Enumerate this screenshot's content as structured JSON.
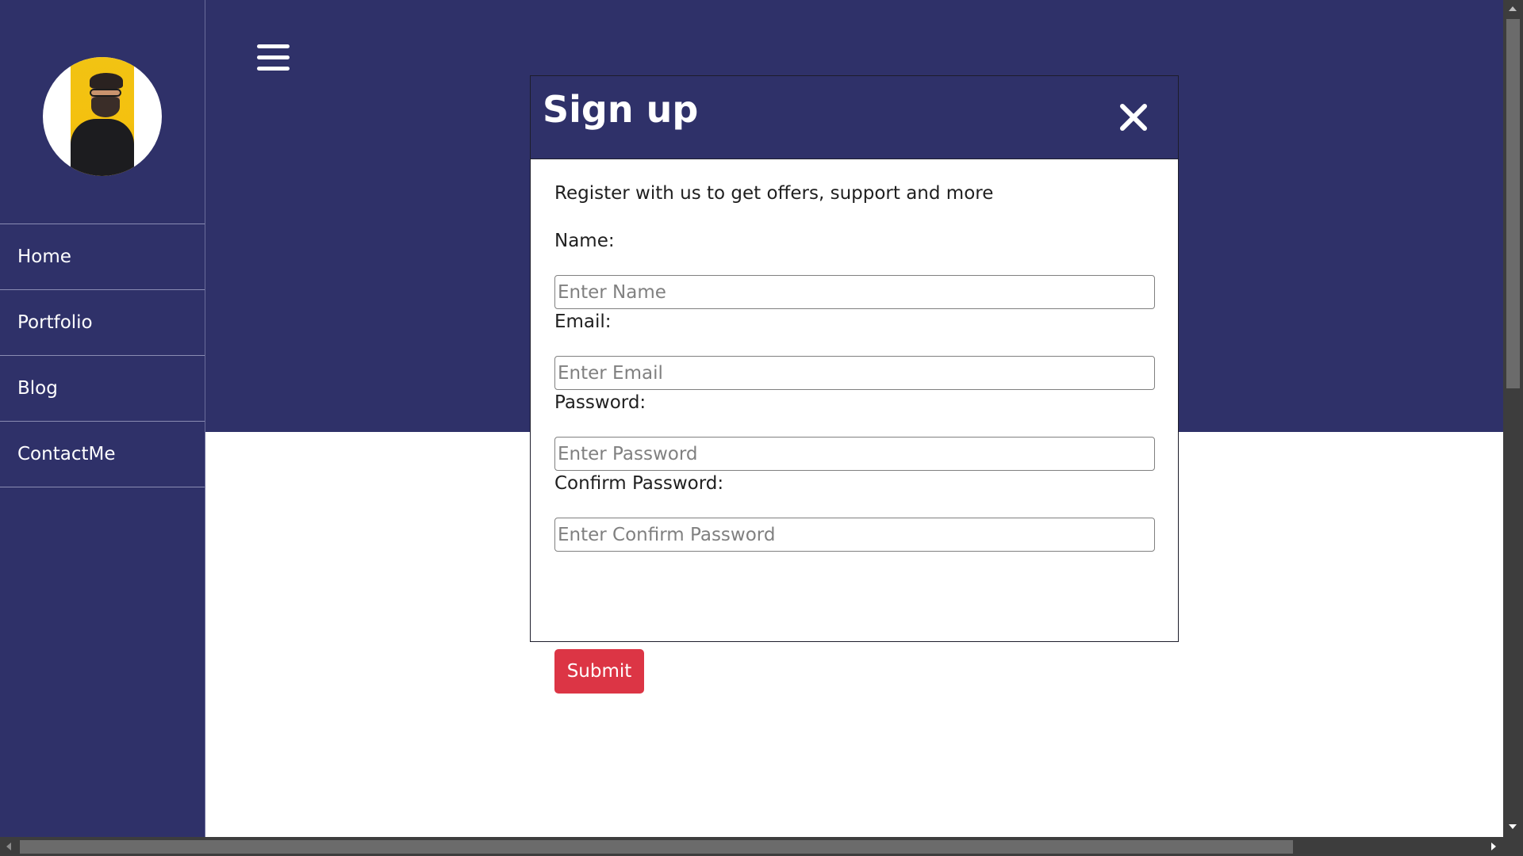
{
  "colors": {
    "brand": "#2f3169",
    "submit": "#dc3545"
  },
  "sidebar": {
    "avatar": "profile-photo",
    "items": [
      {
        "label": "Home"
      },
      {
        "label": "Portfolio"
      },
      {
        "label": "Blog"
      },
      {
        "label": "ContactMe"
      }
    ]
  },
  "header": {
    "menu_icon": "hamburger-icon"
  },
  "modal": {
    "title": "Sign up",
    "close_icon": "close-icon",
    "intro": "Register with us to get offers, support and more",
    "fields": [
      {
        "label": "Name:",
        "placeholder": "Enter Name",
        "value": ""
      },
      {
        "label": "Email:",
        "placeholder": "Enter Email",
        "value": ""
      },
      {
        "label": "Password:",
        "placeholder": "Enter Password",
        "value": ""
      },
      {
        "label": "Confirm Password:",
        "placeholder": "Enter Confirm Password",
        "value": ""
      }
    ],
    "submit_label": "Submit"
  }
}
